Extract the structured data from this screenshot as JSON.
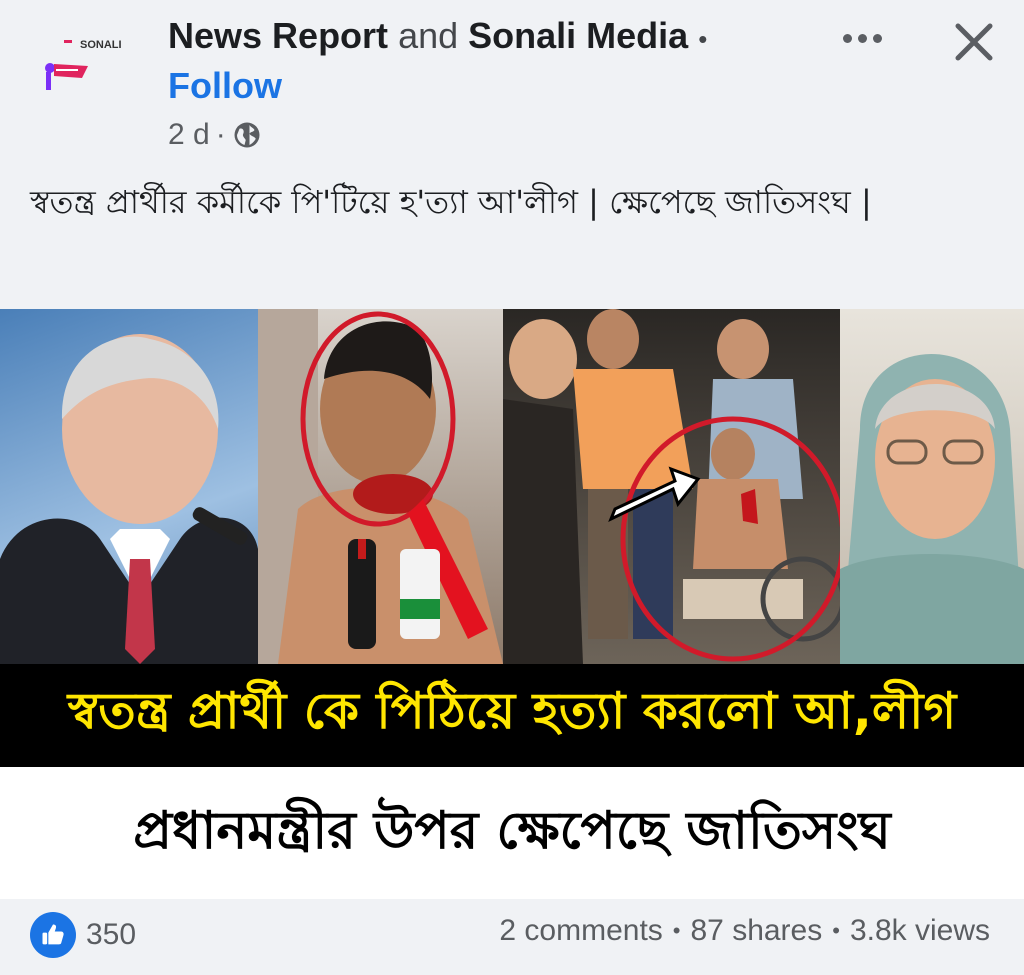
{
  "header": {
    "page_name_1": "News Report",
    "and_word": "and",
    "page_name_2": "Sonali Media",
    "separator": "•",
    "follow_label": "Follow",
    "time": "2 d",
    "meta_separator": "·",
    "privacy_icon": "globe-icon",
    "avatar_logo_text": "SONALI"
  },
  "caption": "স্বতন্ত্র প্রার্থীর কর্মীকে পি'টিয়ে হ'ত্যা আ'লীগ | ক্ষেপেছে জাতিসংঘ |",
  "post_image": {
    "banner_1": "স্বতন্ত্র প্রার্থী কে পিঠিয়ে হত্যা করলো আ,লীগ",
    "banner_2": "প্রধানমন্ত্রীর উপর ক্ষেপেছে জাতিসংঘ",
    "banner_1_color": "#ffe600",
    "banner_1_bg": "#000000"
  },
  "footer": {
    "reaction_icon": "thumbs-up-icon",
    "reaction_count": "350",
    "comments": "2 comments",
    "shares": "87 shares",
    "views": "3.8k views",
    "dot": "•"
  },
  "colors": {
    "accent": "#1b74e4",
    "background": "#f0f2f5",
    "secondary_text": "#5a5d61"
  }
}
